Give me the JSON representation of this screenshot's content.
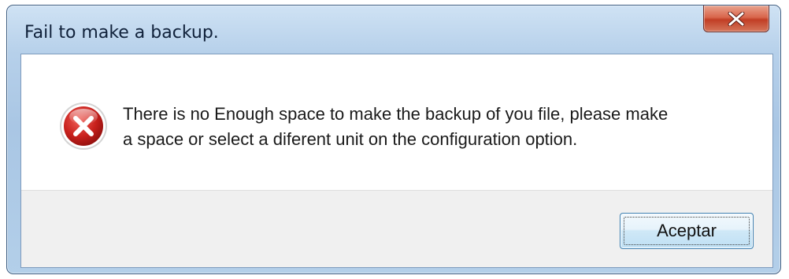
{
  "window": {
    "title": "Fail to make a backup.",
    "close_icon": "close-icon"
  },
  "dialog": {
    "icon": "error-icon",
    "message_lines": [
      "There is no Enough space to make the backup of you file, please make",
      "a space or select a diferent unit on the configuration option."
    ]
  },
  "buttons": {
    "ok_label": "Aceptar"
  },
  "colors": {
    "title_bar": "#b6d0ea",
    "close_button": "#c13e25",
    "error_icon": "#c8201c",
    "button_border": "#3c7fb1",
    "footer_background": "#f0f0f0"
  }
}
